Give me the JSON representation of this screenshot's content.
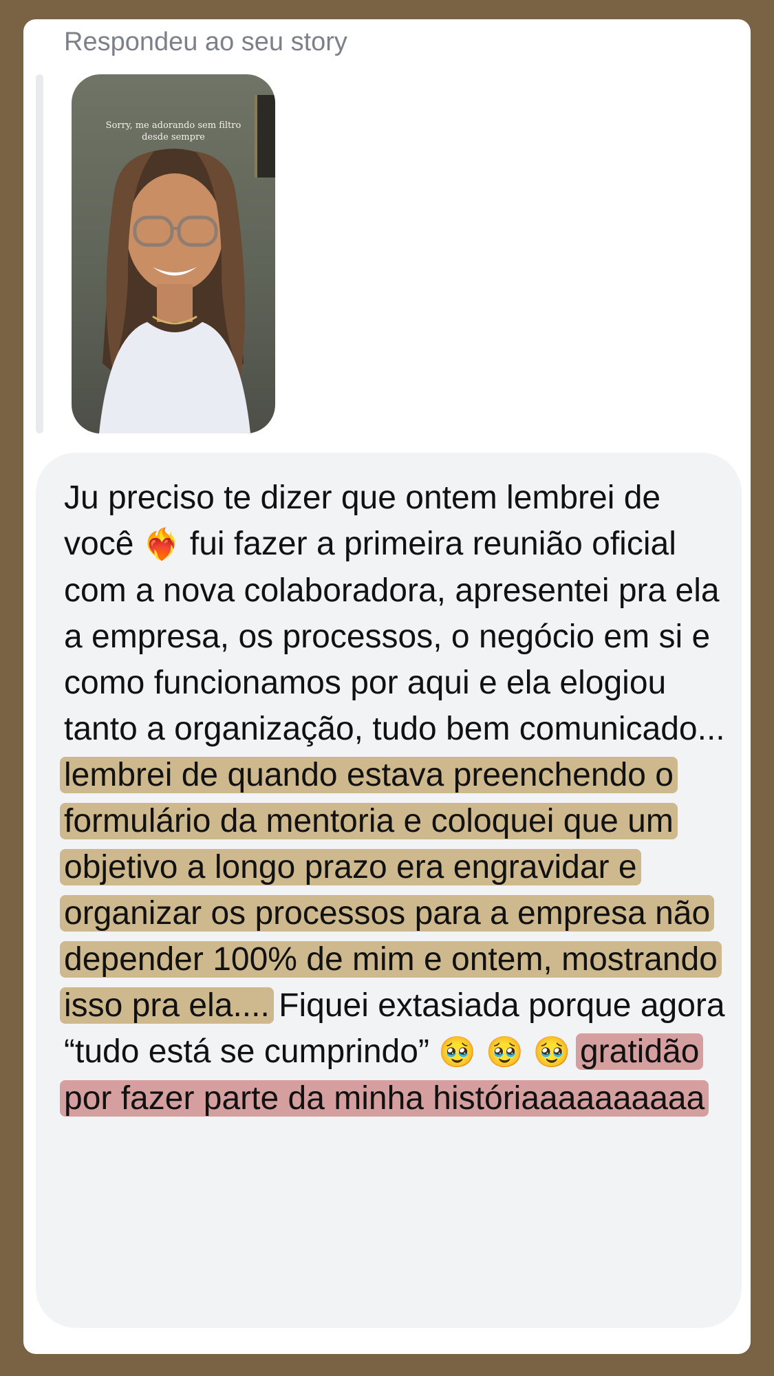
{
  "header": {
    "reply_label": "Respondeu ao seu story"
  },
  "story": {
    "caption": "Sorry, me adorando sem filtro desde sempre"
  },
  "message": {
    "part1": "Ju preciso te dizer que ontem lembrei de você ",
    "emoji_heart": "❤️‍🔥",
    "part2": " fui fazer a primeira reunião oficial com a nova colaboradora, apresentei pra ela a empresa, os processos, o negócio em si e como funcionamos por aqui e ela elogiou tanto a organização, tudo bem comunicado... ",
    "highlight_gold": "lembrei de quando estava preenchendo o formulário da mentoria e coloquei que um objetivo a longo prazo era engravidar e organizar os processos para a empresa não depender 100% de mim e ontem, mostrando isso pra ela....",
    "part3": " Fiquei extasiada porque agora “tudo está se cumprindo” ",
    "emoji_pleading": "🥹 🥹 🥹",
    "highlight_rose": "gratidão por fazer parte da minha históriaaaaaaaaaa"
  },
  "colors": {
    "background": "#7a6344",
    "card": "#ffffff",
    "bubble": "#f2f3f5",
    "highlight_gold": "#c4a670",
    "highlight_rose": "#ce8c8c"
  }
}
